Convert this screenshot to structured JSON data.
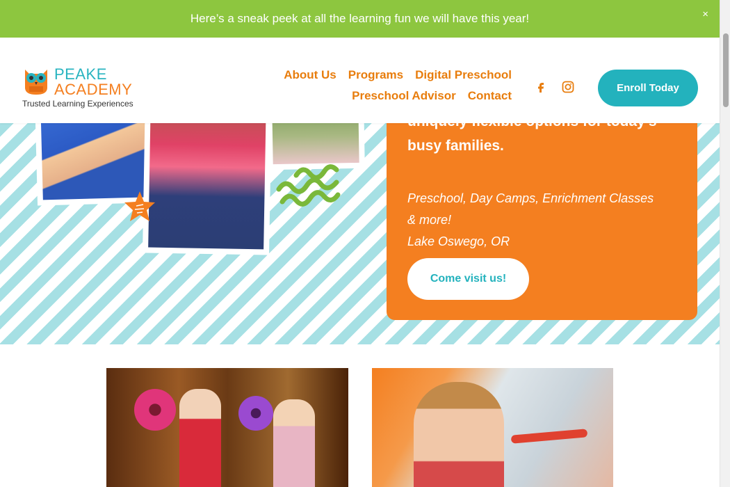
{
  "announcement": {
    "text": "Here’s a sneak peek at all the learning fun we will have this year!",
    "close": "×"
  },
  "logo": {
    "line1": "PEAKE",
    "line2": "ACADEMY",
    "tagline": "Trusted Learning Experiences"
  },
  "nav": {
    "row1": [
      "About Us",
      "Programs",
      "Digital Preschool"
    ],
    "row2": [
      "Preschool Advisor",
      "Contact"
    ]
  },
  "social": {
    "facebook_icon": "facebook-icon",
    "instagram_icon": "instagram-icon"
  },
  "header": {
    "enroll_label": "Enroll Today"
  },
  "hero": {
    "heading_line1": "uniquely flexible options for today’s",
    "heading_line2": "busy families.",
    "sub_line1": "Preschool, Day Camps, Enrichment Classes",
    "sub_line2": "& more!",
    "sub_line3": "Lake Oswego, OR",
    "cta_label": "Come visit us!"
  },
  "colors": {
    "green": "#8dc63f",
    "orange": "#f47f20",
    "teal": "#23b2bd",
    "stripe": "#a6e0e4"
  }
}
